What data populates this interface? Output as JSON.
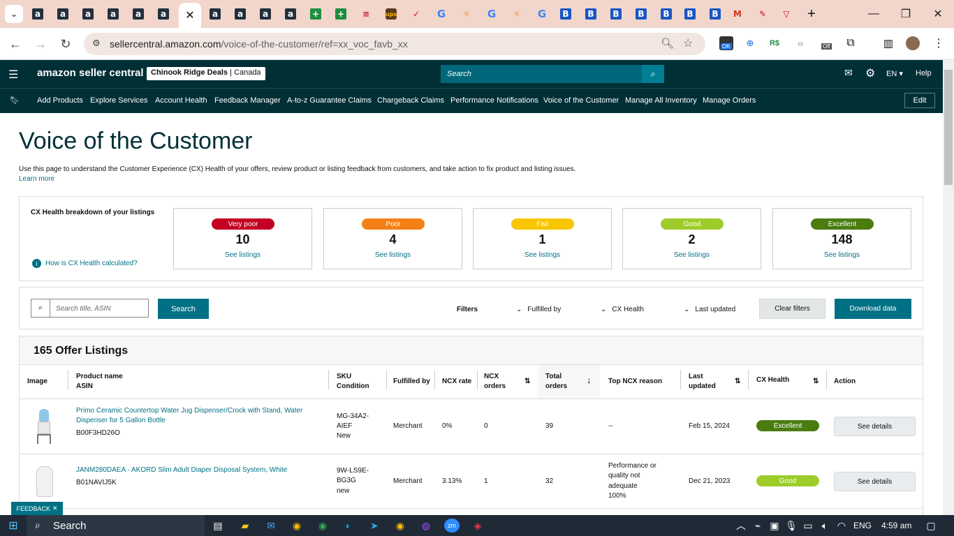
{
  "browser": {
    "tabs": [
      {
        "icon": "amazon-icon",
        "glyph": "a"
      },
      {
        "icon": "amazon-icon",
        "glyph": "a"
      },
      {
        "icon": "amazon-icon",
        "glyph": "a"
      },
      {
        "icon": "amazon-icon",
        "glyph": "a"
      },
      {
        "icon": "amazon-icon",
        "glyph": "a"
      },
      {
        "icon": "amazon-icon",
        "glyph": "a"
      },
      {
        "icon": "amazon-icon",
        "glyph": "a"
      },
      {
        "icon": "amazon-smile-icon",
        "glyph": "a"
      },
      {
        "icon": "amazon-smile-icon",
        "glyph": "a"
      },
      {
        "icon": "amazon-icon",
        "glyph": "a"
      },
      {
        "icon": "sheets-plus-icon",
        "glyph": "+"
      },
      {
        "icon": "sheets-plus-icon",
        "glyph": "+"
      },
      {
        "icon": "stripes-icon",
        "glyph": "≡"
      },
      {
        "icon": "ups-icon",
        "glyph": "ups"
      },
      {
        "icon": "check-icon",
        "glyph": "✓"
      },
      {
        "icon": "google-icon",
        "glyph": "G"
      },
      {
        "icon": "walmart-icon",
        "glyph": "✳"
      },
      {
        "icon": "google-icon",
        "glyph": "G"
      },
      {
        "icon": "walmart-icon",
        "glyph": "✳"
      },
      {
        "icon": "google-icon",
        "glyph": "G"
      },
      {
        "icon": "b-icon",
        "glyph": "B"
      },
      {
        "icon": "b-icon",
        "glyph": "B"
      },
      {
        "icon": "b-icon",
        "glyph": "B"
      },
      {
        "icon": "b-icon",
        "glyph": "B"
      },
      {
        "icon": "b-icon",
        "glyph": "B"
      },
      {
        "icon": "b-icon",
        "glyph": "B"
      },
      {
        "icon": "b-icon",
        "glyph": "B"
      },
      {
        "icon": "gmail-icon",
        "glyph": "M"
      },
      {
        "icon": "pen-icon",
        "glyph": "✎"
      },
      {
        "icon": "triangle-icon",
        "glyph": "▽"
      }
    ],
    "url_domain": "sellercentral.amazon.com",
    "url_path": "/voice-of-the-customer/ref=xx_voc_favb_xx",
    "ext_badge_ok": "OK",
    "ext_badge_off": "Off"
  },
  "header": {
    "logo": "amazon seller central",
    "store_name": "Chinook Ridge Deals",
    "store_region": "Canada",
    "search_placeholder": "Search",
    "language": "EN",
    "help": "Help"
  },
  "nav": {
    "items": [
      "Add Products",
      "Explore Services",
      "Account Health",
      "Feedback Manager",
      "A-to-z Guarantee Claims",
      "Chargeback Claims",
      "Performance Notifications",
      "Voice of the Customer",
      "Manage All Inventory",
      "Manage Orders"
    ],
    "edit": "Edit"
  },
  "page": {
    "title": "Voice of the Customer",
    "description": "Use this page to understand the Customer Experience (CX) Health of your offers, review product or listing feedback from customers, and take action to fix product and listing issues.",
    "learn_more": "Learn more"
  },
  "cx_health": {
    "heading": "CX Health breakdown of your listings",
    "info_link": "How is CX Health calculated?",
    "cards": [
      {
        "label": "Very poor",
        "count": "10",
        "link": "See listings",
        "color": "#c40023"
      },
      {
        "label": "Poor",
        "count": "4",
        "link": "See listings",
        "color": "#f57f17"
      },
      {
        "label": "Fair",
        "count": "1",
        "link": "See listings",
        "color": "#f7c600"
      },
      {
        "label": "Good",
        "count": "2",
        "link": "See listings",
        "color": "#9dcc2b"
      },
      {
        "label": "Excellent",
        "count": "148",
        "link": "See listings",
        "color": "#4a7c10"
      }
    ]
  },
  "filters": {
    "search_placeholder": "Search title, ASIN",
    "search_button": "Search",
    "label": "Filters",
    "fulfilled_by": "Fulfilled by",
    "cx_health": "CX Health",
    "last_updated": "Last updated",
    "clear": "Clear filters",
    "download": "Download data"
  },
  "table": {
    "title": "165 Offer Listings",
    "headers": {
      "image": "Image",
      "product_name": "Product name",
      "asin": "ASIN",
      "sku": "SKU",
      "condition": "Condition",
      "fulfilled_by": "Fulfilled by",
      "ncx_rate": "NCX rate",
      "ncx_orders_1": "NCX",
      "ncx_orders_2": "orders",
      "total_orders_1": "Total",
      "total_orders_2": "orders",
      "top_reason": "Top NCX reason",
      "last_updated_1": "Last",
      "last_updated_2": "updated",
      "cx_health": "CX Health",
      "action": "Action"
    },
    "rows": [
      {
        "name_line1": "Primo Ceramic Countertop Water Jug Dispenser/Crock with Stand, Water",
        "name_line2": "Dispenser for 5 Gallon Bottle",
        "asin": "B00F3HD26O",
        "sku_line1": "MG-34A2-",
        "sku_line2": "AIEF",
        "condition": "New",
        "fulfilled": "Merchant",
        "ncx_rate": "0%",
        "ncx_orders": "0",
        "total_orders": "39",
        "reason": [
          "--"
        ],
        "last_updated": "Feb 15, 2024",
        "health": "Excellent",
        "health_color": "#4a7c10",
        "action": "See details"
      },
      {
        "name_line1": "JANM280DAEA - AKORD Slim Adult Diaper Disposal System, White",
        "name_line2": "",
        "asin": "B01NAVIJ5K",
        "sku_line1": "9W-LS9E-",
        "sku_line2": "BG3G",
        "condition": "new",
        "fulfilled": "Merchant",
        "ncx_rate": "3.13%",
        "ncx_orders": "1",
        "total_orders": "32",
        "reason": [
          "Performance or",
          "quality not",
          "adequate",
          "100%"
        ],
        "last_updated": "Dec 21, 2023",
        "health": "Good",
        "health_color": "#9dcc2b",
        "action": "See details"
      }
    ]
  },
  "feedback": "FEEDBACK",
  "taskbar": {
    "search": "Search",
    "lang": "ENG",
    "time": "4:59 am"
  }
}
